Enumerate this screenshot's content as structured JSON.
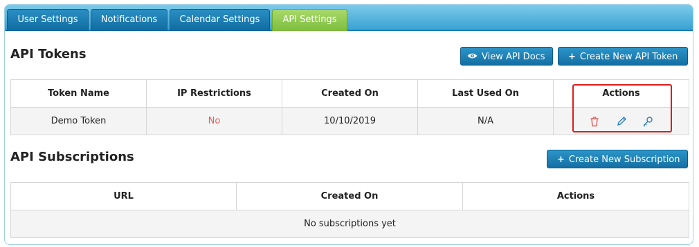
{
  "tabs": [
    {
      "label": "User Settings"
    },
    {
      "label": "Notifications"
    },
    {
      "label": "Calendar Settings"
    },
    {
      "label": "API Settings",
      "active": true
    }
  ],
  "tokens": {
    "title": "API Tokens",
    "view_docs_label": "View API Docs",
    "create_label": "Create New API Token",
    "columns": [
      "Token Name",
      "IP Restrictions",
      "Created On",
      "Last Used On",
      "Actions"
    ],
    "rows": [
      {
        "name": "Demo Token",
        "ip": "No",
        "created": "10/10/2019",
        "last_used": "N/A"
      }
    ]
  },
  "subscriptions": {
    "title": "API Subscriptions",
    "create_label": "Create New Subscription",
    "columns": [
      "URL",
      "Created On",
      "Actions"
    ],
    "empty_text": "No subscriptions yet"
  },
  "colors": {
    "tab_active": "#7cbd3d",
    "tab_inactive": "#106a9f",
    "button": "#146fa3",
    "delete_icon": "#e55a5a",
    "edit_icon": "#2b7fc0",
    "highlight_border": "#e01b1b"
  },
  "icons": {
    "view_docs": "eye-icon",
    "create": "plus-icon",
    "delete": "trash-icon",
    "edit": "pencil-icon",
    "key": "key-icon"
  }
}
